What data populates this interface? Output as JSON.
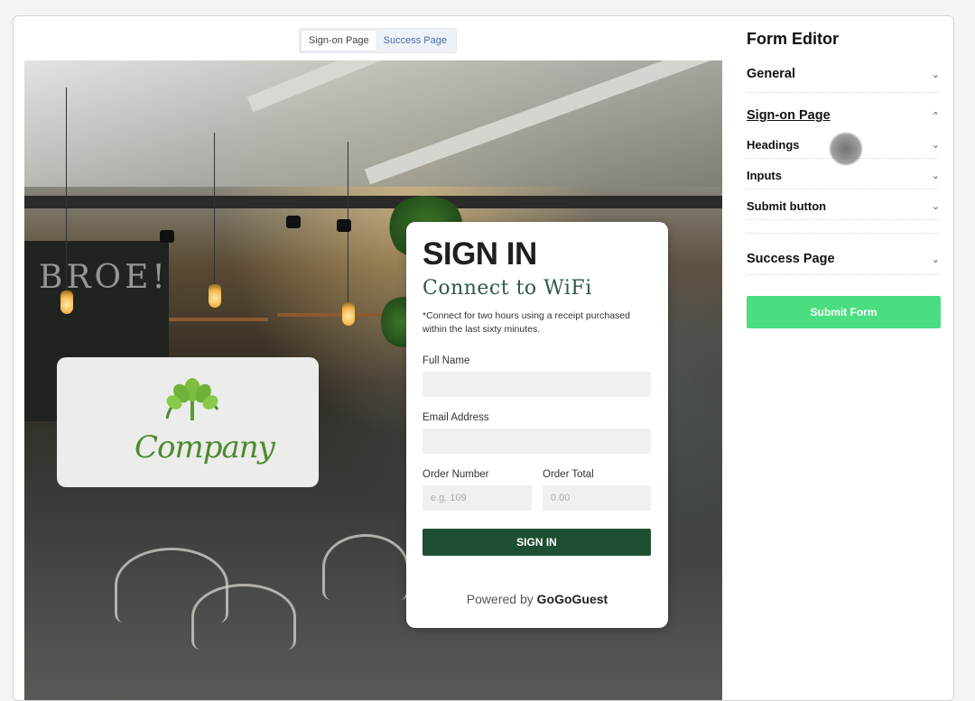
{
  "tabs": [
    {
      "label": "Sign-on Page"
    },
    {
      "label": "Success Page"
    }
  ],
  "preview": {
    "background_text": "BROE!",
    "logo": {
      "text": "Company"
    },
    "card": {
      "title": "SIGN IN",
      "subtitle": "Connect to WiFi",
      "note": "*Connect for two hours using a receipt purchased within the last sixty minutes.",
      "fields": {
        "full_name_label": "Full Name",
        "email_label": "Email Address",
        "order_number_label": "Order Number",
        "order_number_placeholder": "e.g. 109",
        "order_total_label": "Order Total",
        "order_total_placeholder": "0.00"
      },
      "button_label": "SIGN IN",
      "powered_prefix": "Powered by",
      "powered_brand": "GoGoGuest"
    }
  },
  "editor": {
    "title": "Form Editor",
    "sections": {
      "general": "General",
      "sign_on_page": "Sign-on Page",
      "headings": "Headings",
      "inputs": "Inputs",
      "submit_button": "Submit button",
      "success_page": "Success Page"
    },
    "submit_label": "Submit Form"
  },
  "colors": {
    "signin_button": "#1e4f32",
    "submit_form_button": "#4ade80",
    "subtitle": "#2e5a44",
    "logo_green": "#4b8a2e"
  }
}
